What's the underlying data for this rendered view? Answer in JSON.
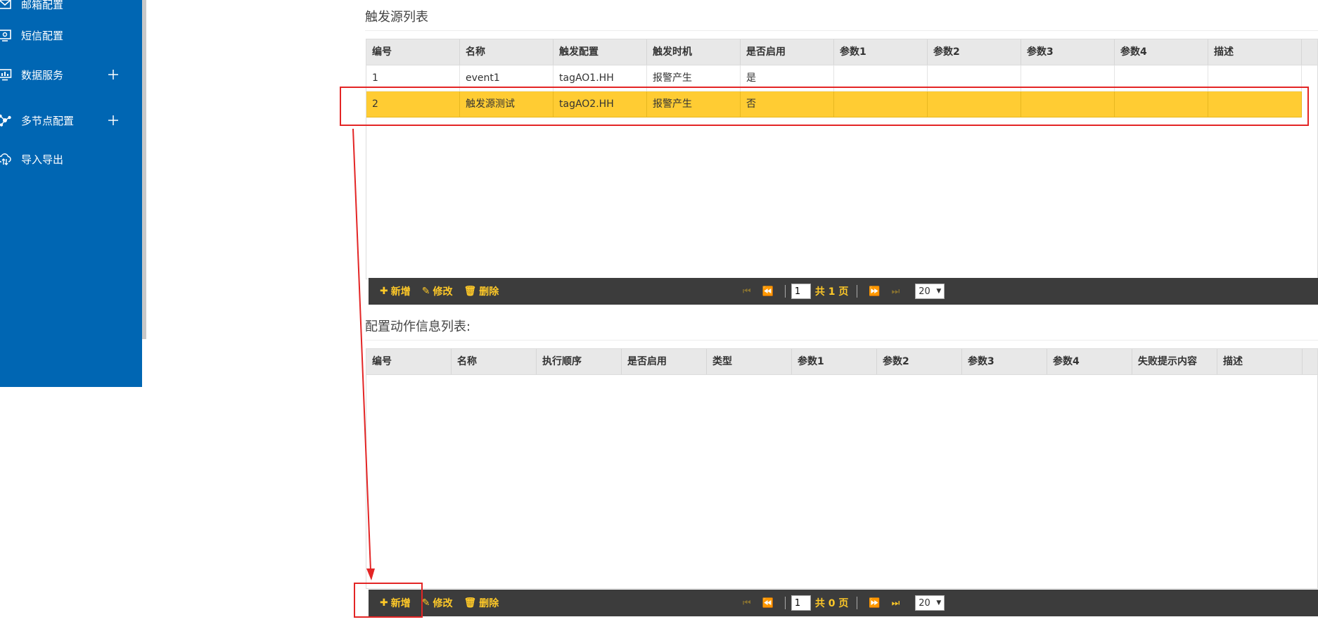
{
  "sidebar": {
    "items": [
      {
        "label": "邮箱配置",
        "icon": "mail-icon"
      },
      {
        "label": "短信配置",
        "icon": "sms-icon"
      },
      {
        "label": "数据服务",
        "icon": "monitor-chart-icon",
        "expandable": true
      },
      {
        "label": "多节点配置",
        "icon": "nodes-icon",
        "expandable": true
      },
      {
        "label": "导入导出",
        "icon": "cloud-transfer-icon"
      }
    ]
  },
  "trigger_section": {
    "title": "触发源列表",
    "columns": [
      "编号",
      "名称",
      "触发配置",
      "触发时机",
      "是否启用",
      "参数1",
      "参数2",
      "参数3",
      "参数4",
      "描述"
    ],
    "rows": [
      {
        "cells": [
          "1",
          "event1",
          "tagAO1.HH",
          "报警产生",
          "是",
          "",
          "",
          "",
          "",
          ""
        ],
        "selected": false
      },
      {
        "cells": [
          "2",
          "触发源测试",
          "tagAO2.HH",
          "报警产生",
          "否",
          "",
          "",
          "",
          "",
          ""
        ],
        "selected": true
      }
    ],
    "toolbar": {
      "add": "新增",
      "edit": "修改",
      "delete": "删除",
      "page": "1",
      "total_text": "共 1 页",
      "page_size": "20"
    }
  },
  "action_section": {
    "title": "配置动作信息列表:",
    "columns": [
      "编号",
      "名称",
      "执行顺序",
      "是否启用",
      "类型",
      "参数1",
      "参数2",
      "参数3",
      "参数4",
      "失败提示内容",
      "描述"
    ],
    "rows": [],
    "toolbar": {
      "add": "新增",
      "edit": "修改",
      "delete": "删除",
      "page": "1",
      "total_text": "共 0 页",
      "page_size": "20"
    }
  },
  "colors": {
    "sidebar_bg": "#0066b3",
    "selected_row": "#ffcc33",
    "toolbar_bg": "#3c3c3c",
    "toolbar_text": "#ffc928",
    "annotation": "#e32525"
  }
}
